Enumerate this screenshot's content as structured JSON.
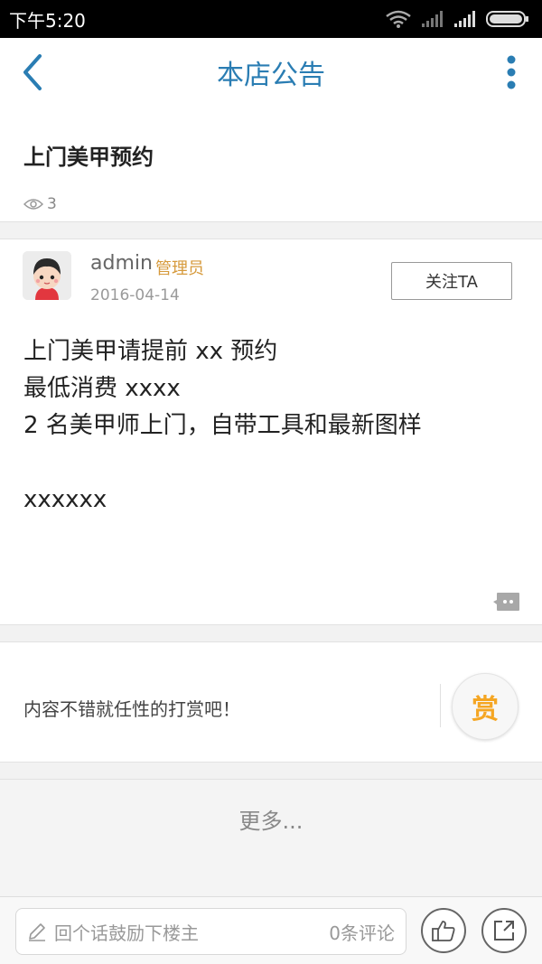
{
  "status_bar": {
    "time": "下午5:20"
  },
  "nav": {
    "title": "本店公告"
  },
  "post": {
    "title": "上门美甲预约",
    "views": "3",
    "author": "admin",
    "role": "管理员",
    "date": "2016-04-14",
    "follow_label": "关注TA",
    "body_lines": [
      "上门美甲请提前 xx 预约",
      "最低消费 xxxx",
      "2 名美甲师上门，自带工具和最新图样",
      "",
      "xxxxxx"
    ]
  },
  "reward": {
    "prompt": "内容不错就任性的打赏吧！",
    "button_label": "赏"
  },
  "more": {
    "label": "更多..."
  },
  "bottom_bar": {
    "comment_placeholder": "回个话鼓励下楼主",
    "comment_count": "0条评论"
  },
  "colors": {
    "accent": "#2a7db3",
    "role": "#d69a3c",
    "reward": "#f5a623"
  }
}
